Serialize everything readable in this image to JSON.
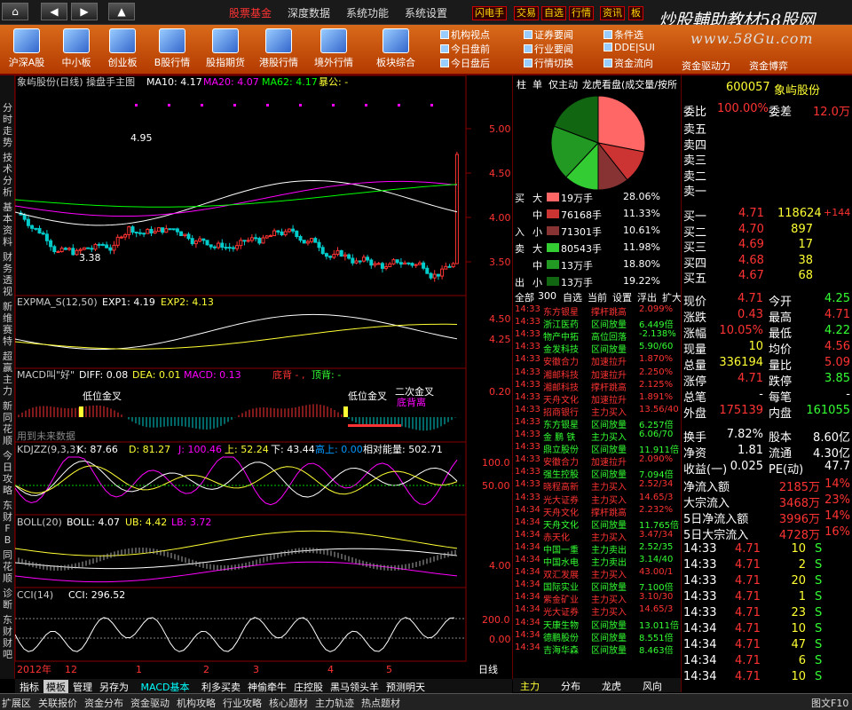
{
  "nav": {
    "home": "⌂",
    "back": "◀",
    "fwd": "▶",
    "up": "▲"
  },
  "menu": [
    {
      "label": "股票基金",
      "active": true
    },
    {
      "label": "深度数据"
    },
    {
      "label": "系统功能"
    },
    {
      "label": "系统设置"
    }
  ],
  "hotkeys": [
    "闪电手",
    "交易",
    "自选",
    "行情",
    "资讯",
    "板"
  ],
  "banner": {
    "line1": "炒股輔助教材58股网",
    "line2": "www.58Gu.com"
  },
  "toolbar": {
    "items": [
      "沪深A股",
      "中小板",
      "创业板",
      "B股行情",
      "股指期货",
      "港股行情",
      "境外行情",
      "板块综合"
    ],
    "links_col1": [
      "机构视点",
      "今日盘前",
      "今日盘后"
    ],
    "links_col2": [
      "证券要闻",
      "行业要闻",
      "行情切换"
    ],
    "links_col3": [
      "条件选",
      "DDE|SUI",
      "资金流向"
    ],
    "extra": [
      "资金驱动力",
      "资金博弈"
    ]
  },
  "leftbar": [
    "分时走势",
    "技术分析",
    "基本资料",
    "财务透视",
    "新维赛特",
    "超赢主力",
    "新同花顺",
    "今日攻略",
    "东财FB",
    "同花顺",
    "诊断",
    "东财财吧"
  ],
  "chart": {
    "main_title": "象屿股份(日线) 操盘手主图",
    "ma10": "MA10: 4.17",
    "ma20": "MA20: 4.07",
    "ma62": "MA62: 4.17",
    "fx": "暴公: -",
    "price_ticks": [
      "5.00",
      "4.50",
      "4.00",
      "3.50"
    ],
    "hi": "4.95",
    "lo": "3.38",
    "expma_title": "EXPMA_S(12,50)",
    "exp1": "EXP1: 4.19",
    "exp2": "EXP2: 4.13",
    "expma_ticks": [
      "4.50",
      "4.25"
    ],
    "macd_title": "MACD叫\"好\"",
    "diff": "DIFF: 0.08",
    "dea": "DEA: 0.01",
    "macd": "MACD: 0.13",
    "dibei": "底背 - ,",
    "dingbei": "顶背: -",
    "macd_ann1": "低位金叉",
    "macd_ann2": "低位金叉",
    "macd_ann3": "二次金叉",
    "macd_ann4": "底背离",
    "macd_tick": "0.20",
    "macd_note": "用到未来数据",
    "kd_title": "KDJZZ(9,3,3)",
    "kd_k": "K: 87.66",
    "kd_d": "D: 81.27",
    "kd_j": "J: 100.46",
    "kd_up": "上: 52.24",
    "kd_down": "下: 43.44",
    "kd_hi": "高上: 0.00",
    "kd_rel": "相对能量: 502.71",
    "kd_ticks": [
      "100.0",
      "50.00"
    ],
    "boll_title": "BOLL(20)",
    "boll": "BOLL: 4.07",
    "ub": "UB: 4.42",
    "lb": "LB: 3.72",
    "boll_tick": "4.00",
    "cci_title": "CCI(14)",
    "cci": "CCI: 296.52",
    "cci_ticks": [
      "200.0",
      "0.00"
    ],
    "xaxis": [
      "2012年",
      "12",
      "1",
      "2",
      "3",
      "4",
      "5"
    ],
    "period": "日线"
  },
  "bottabs": [
    "指标",
    "模板",
    "管理",
    "另存为",
    "MACD基本",
    "利多买卖",
    "神偷牵牛",
    "庄控股",
    "黑马领头羊",
    "预测明天"
  ],
  "rpanel": {
    "tabs": [
      "柱",
      "单",
      "仅主动",
      "龙虎看盘(成交量/按所"
    ],
    "flow": [
      {
        "side": "买",
        "lvl": "大",
        "amt": "19万手",
        "pct": "28.06%",
        "color": "#f66"
      },
      {
        "side": "",
        "lvl": "中",
        "amt": "76168手",
        "pct": "11.33%",
        "color": "#c33"
      },
      {
        "side": "入",
        "lvl": "小",
        "amt": "71301手",
        "pct": "10.61%",
        "color": "#833"
      },
      {
        "side": "卖",
        "lvl": "大",
        "amt": "80543手",
        "pct": "11.98%",
        "color": "#3c3"
      },
      {
        "side": "",
        "lvl": "中",
        "amt": "13万手",
        "pct": "18.80%",
        "color": "#292"
      },
      {
        "side": "出",
        "lvl": "小",
        "amt": "13万手",
        "pct": "19.22%",
        "color": "#161"
      }
    ],
    "pie": [
      28.06,
      11.33,
      10.61,
      11.98,
      18.8,
      19.22
    ],
    "subtabs": [
      "全部",
      "300",
      "自选",
      "当前",
      "设置",
      "浮出",
      "扩大"
    ],
    "news": [
      [
        "14:33",
        "东方银星",
        "撑杆跳高",
        "2.099%",
        "r"
      ],
      [
        "14:33",
        "浙江医药",
        "区间放量",
        "6.449倍",
        "g"
      ],
      [
        "14:33",
        "物产中拓",
        "高位回落",
        "-2.138%",
        "g"
      ],
      [
        "14:33",
        "金发科技",
        "区间放量",
        "5.90/60",
        "g"
      ],
      [
        "14:33",
        "安徽合力",
        "加速拉升",
        "1.870%",
        "r"
      ],
      [
        "14:33",
        "湘邮科技",
        "加速拉升",
        "2.250%",
        "r"
      ],
      [
        "14:33",
        "湘邮科技",
        "撑杆跳高",
        "2.125%",
        "r"
      ],
      [
        "14:33",
        "天舟文化",
        "加速拉升",
        "1.891%",
        "r"
      ],
      [
        "14:33",
        "招商银行",
        "主力买入",
        "13.56/40",
        "r"
      ],
      [
        "14:33",
        "东方银星",
        "区间放量",
        "6.257倍",
        "g"
      ],
      [
        "14:33",
        "金 鹏 铁",
        "主力买入",
        "6.06/70",
        "g"
      ],
      [
        "14:33",
        "鼎立股份",
        "区间放量",
        "11.911倍",
        "g"
      ],
      [
        "14:33",
        "安徽合力",
        "加速拉升",
        "2.090%",
        "r"
      ],
      [
        "14:33",
        "强生控股",
        "区间放量",
        "7.094倍",
        "g"
      ],
      [
        "14:33",
        "晓程高新",
        "主力买入",
        "2.52/34",
        "r"
      ],
      [
        "14:33",
        "光大证券",
        "主力买入",
        "14.65/3",
        "r"
      ],
      [
        "14:34",
        "天舟文化",
        "撑杆跳高",
        "2.232%",
        "r"
      ],
      [
        "14:34",
        "天舟文化",
        "区间放量",
        "11.765倍",
        "g"
      ],
      [
        "14:34",
        "赤天化",
        "主力买入",
        "3.47/34",
        "r"
      ],
      [
        "14:34",
        "中国一重",
        "主力卖出",
        "2.52/35",
        "g"
      ],
      [
        "14:34",
        "中国水电",
        "主力卖出",
        "3.14/40",
        "g"
      ],
      [
        "14:34",
        "双汇发展",
        "主力买入",
        "43.00/1",
        "r"
      ],
      [
        "14:34",
        "国际实业",
        "区间放量",
        "7.100倍",
        "g"
      ],
      [
        "14:34",
        "紫金矿业",
        "主力买入",
        "3.10/30",
        "r"
      ],
      [
        "14:34",
        "光大证券",
        "主力买入",
        "14.65/3",
        "r"
      ],
      [
        "14:34",
        "天康生物",
        "区间放量",
        "13.011倍",
        "g"
      ],
      [
        "14:34",
        "德鹏股份",
        "区间放量",
        "8.551倍",
        "g"
      ],
      [
        "14:34",
        "吉海华森",
        "区间放量",
        "8.463倍",
        "g"
      ]
    ],
    "bottom": [
      "主力",
      "分布",
      "龙虎",
      "风向"
    ]
  },
  "quote": {
    "code": "600057",
    "name": "象屿股份",
    "weibi_l": "委比",
    "weibi": "100.00%",
    "weicha_l": "委差",
    "weicha": "12.0万",
    "sell": [
      "卖五",
      "卖四",
      "卖三",
      "卖二",
      "卖一"
    ],
    "buy": [
      [
        "买一",
        "4.71",
        "118624",
        "+144"
      ],
      [
        "买二",
        "4.70",
        "897",
        ""
      ],
      [
        "买三",
        "4.69",
        "17",
        ""
      ],
      [
        "买四",
        "4.68",
        "38",
        ""
      ],
      [
        "买五",
        "4.67",
        "68",
        ""
      ]
    ],
    "stats": [
      [
        "现价",
        "4.71",
        "今开",
        "4.25"
      ],
      [
        "涨跌",
        "0.43",
        "最高",
        "4.71"
      ],
      [
        "涨幅",
        "10.05%",
        "最低",
        "4.22"
      ],
      [
        "现量",
        "10",
        "均价",
        "4.56"
      ],
      [
        "总量",
        "336194",
        "量比",
        "5.09"
      ],
      [
        "涨停",
        "4.71",
        "跌停",
        "3.85"
      ],
      [
        "总笔",
        "-",
        "每笔",
        "-"
      ],
      [
        "外盘",
        "175139",
        "内盘",
        "161055"
      ]
    ],
    "stats2": [
      [
        "换手",
        "7.82%",
        "股本",
        "8.60亿"
      ],
      [
        "净资",
        "1.81",
        "流通",
        "4.30亿"
      ],
      [
        "收益(一)",
        "0.025",
        "PE(动)",
        "47.7"
      ]
    ],
    "flows": [
      [
        "净流入额",
        "2185万",
        "14%"
      ],
      [
        "大宗流入",
        "3468万",
        "23%"
      ],
      [
        "5日净流入额",
        "3996万",
        "14%"
      ],
      [
        "5日大宗流入",
        "4728万",
        "16%"
      ]
    ],
    "ticks": [
      [
        "14:33",
        "4.71",
        "10",
        "S"
      ],
      [
        "14:33",
        "4.71",
        "2",
        "S"
      ],
      [
        "14:33",
        "4.71",
        "20",
        "S"
      ],
      [
        "14:33",
        "4.71",
        "1",
        "S"
      ],
      [
        "14:33",
        "4.71",
        "23",
        "S"
      ],
      [
        "14:34",
        "4.71",
        "10",
        "S"
      ],
      [
        "14:34",
        "4.71",
        "47",
        "S"
      ],
      [
        "14:34",
        "4.71",
        "6",
        "S"
      ],
      [
        "14:34",
        "4.71",
        "10",
        "S"
      ]
    ],
    "tabs": [
      "笔",
      "价",
      "细",
      "盘",
      "势",
      "联",
      "值",
      "主",
      "筹"
    ]
  },
  "status": [
    "扩展区",
    "关联报价",
    "资金分布",
    "资金驱动",
    "机构攻略",
    "行业攻略",
    "核心题材",
    "主力轨迹",
    "热点题材",
    "图文F10"
  ]
}
